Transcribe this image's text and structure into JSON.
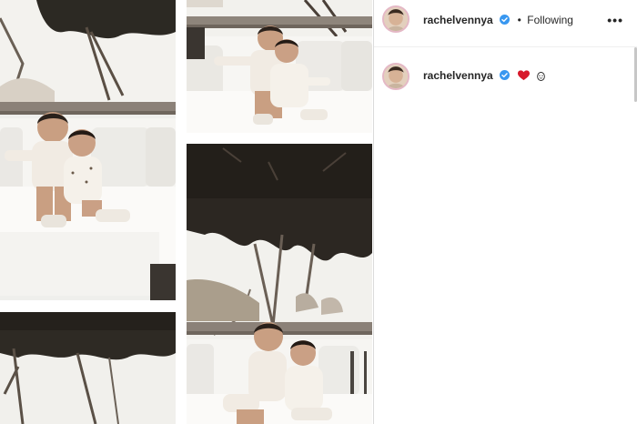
{
  "post": {
    "username": "rachelvennya",
    "follow_status": "Following",
    "separator": "•",
    "more_label": "•••"
  },
  "caption": {
    "username": "rachelvennya",
    "emojis": [
      "heart-icon",
      "face-icon"
    ]
  },
  "colors": {
    "verified": "#3897f0",
    "heart": "#d7182a",
    "text": "#262626",
    "divider": "#dbdbdb"
  }
}
